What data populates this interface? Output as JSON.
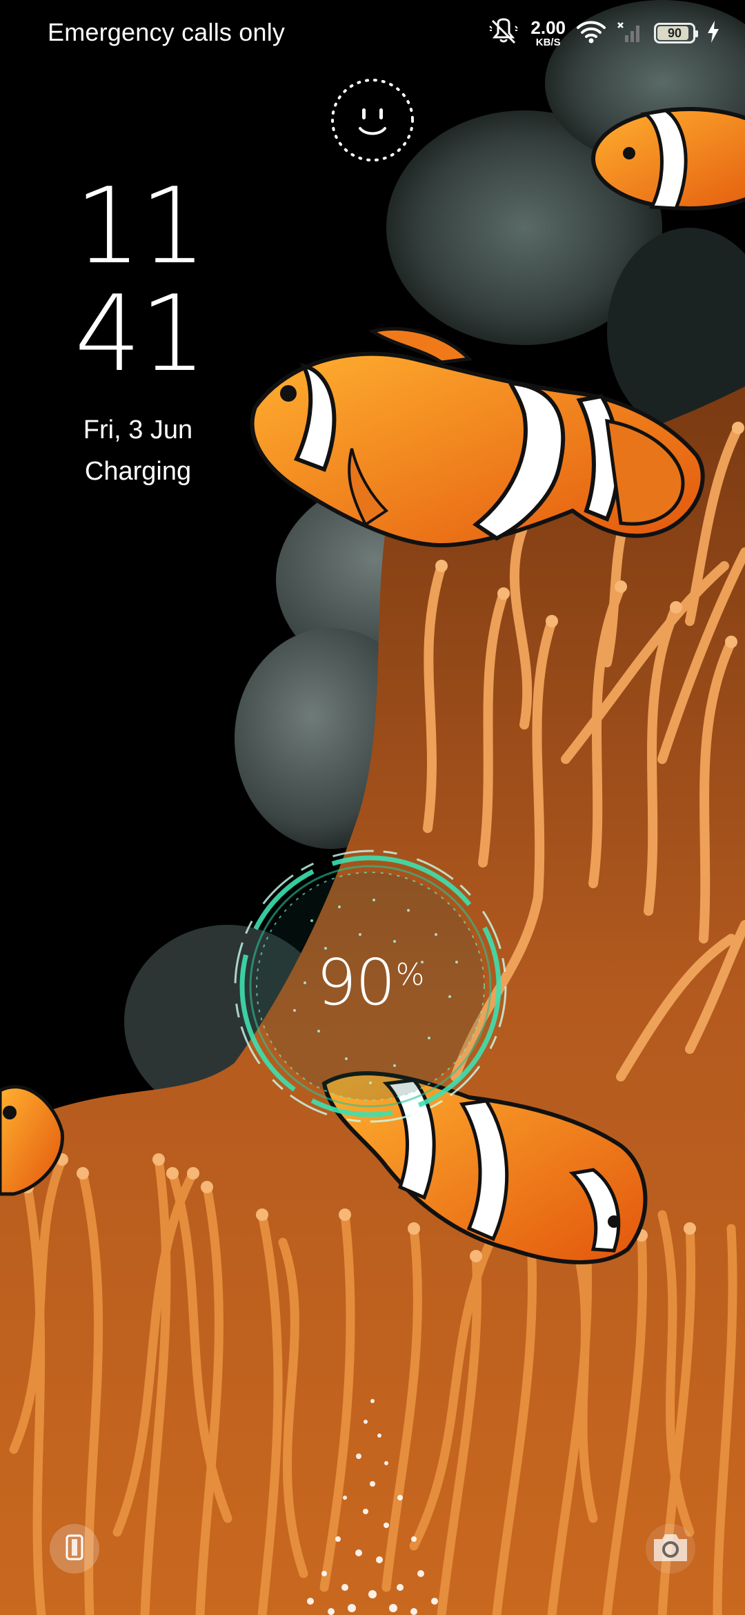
{
  "status_bar": {
    "carrier": "Emergency calls only",
    "net_speed_value": "2.00",
    "net_speed_unit": "KB/S",
    "battery_percent": 90,
    "battery_label": "90",
    "icons": [
      "silent-mode-icon",
      "wifi-icon",
      "no-sim-signal-icon",
      "battery-icon",
      "charging-bolt-icon"
    ]
  },
  "lockscreen": {
    "clock_hours": "11",
    "clock_minutes": "41",
    "date": "Fri, 3 Jun",
    "status": "Charging"
  },
  "charging": {
    "percent_value": "90",
    "percent_symbol": "%",
    "ring_color": "#3de0b0"
  },
  "shortcuts": {
    "left_icon": "phone-icon",
    "right_icon": "camera-icon"
  },
  "wallpaper": {
    "subject": "clownfish-anemone",
    "accent_orange": "#f07a1a",
    "anemone_color": "#e39a52"
  }
}
